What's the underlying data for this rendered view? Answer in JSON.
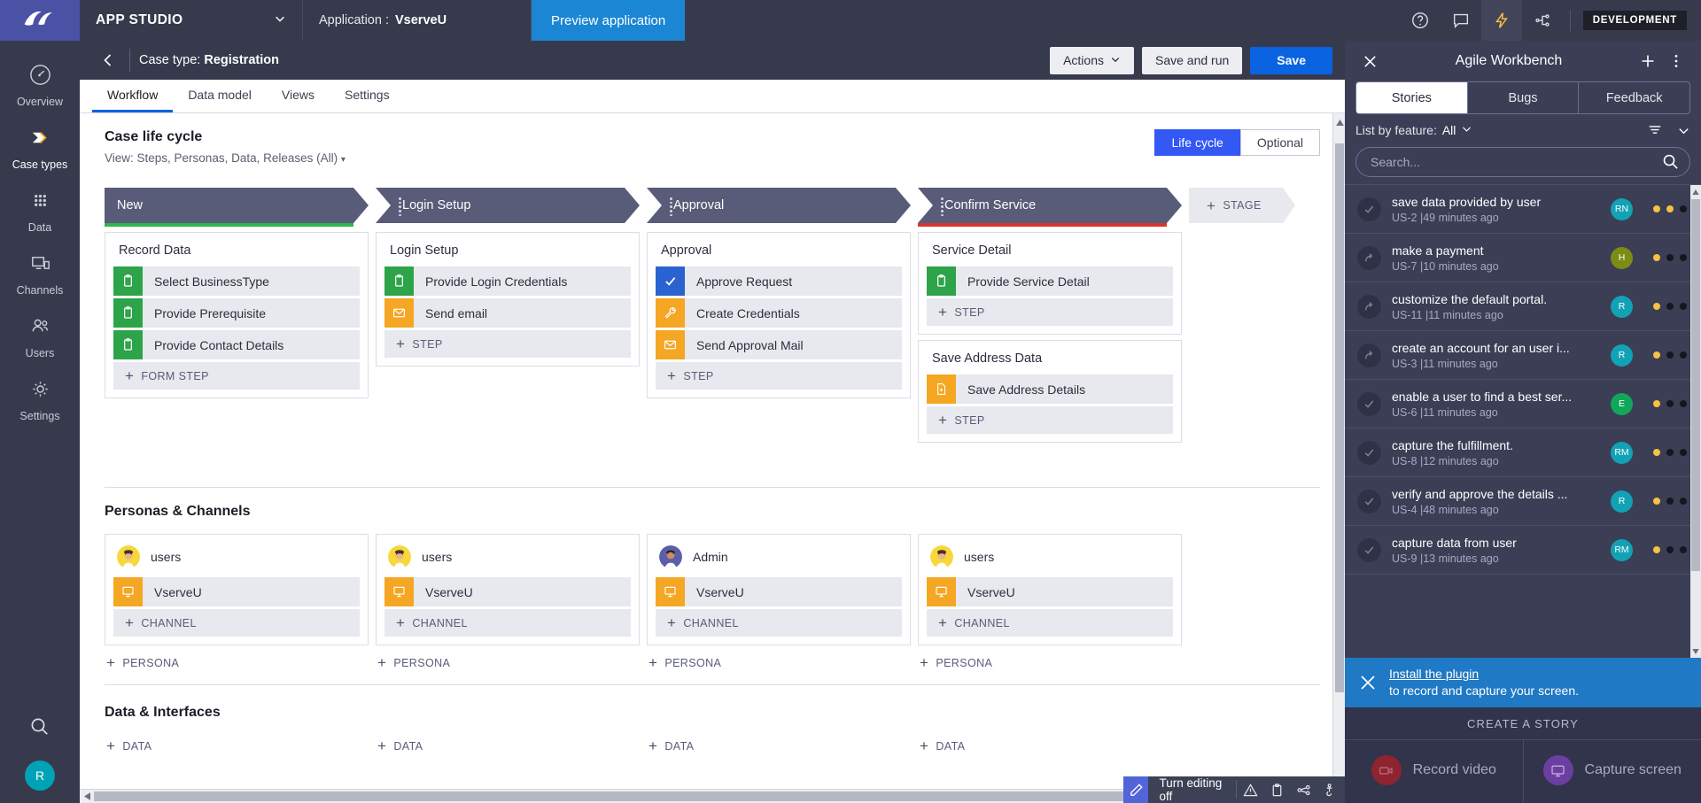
{
  "topbar": {
    "logo_icon": "pega-logo-icon",
    "studio_label": "APP STUDIO",
    "studio_caret_icon": "chevron-down-icon",
    "application_label": "Application :",
    "application_value": "VserveU",
    "preview_label": "Preview application",
    "icons": [
      "help-icon",
      "chat-icon",
      "lightning-icon",
      "share-tree-icon"
    ],
    "env_badge": "DEVELOPMENT"
  },
  "sidebar": {
    "items": [
      {
        "label": "Overview",
        "icon": "gauge-icon",
        "active": false
      },
      {
        "label": "Case types",
        "icon": "case-chevron-icon",
        "active": true
      },
      {
        "label": "Data",
        "icon": "dots-grid-icon",
        "active": false
      },
      {
        "label": "Channels",
        "icon": "devices-icon",
        "active": false
      },
      {
        "label": "Users",
        "icon": "users-icon",
        "active": false
      },
      {
        "label": "Settings",
        "icon": "gear-icon",
        "active": false
      }
    ],
    "search_icon": "search-icon",
    "avatar_initial": "R",
    "avatar_color": "#00a3b5"
  },
  "casebar": {
    "back_icon": "arrow-left-icon",
    "prefix": "Case type:",
    "name": "Registration",
    "actions_label": "Actions",
    "actions_caret_icon": "chevron-down-icon",
    "save_and_run_label": "Save and run",
    "save_label": "Save"
  },
  "tabs": [
    {
      "label": "Workflow",
      "active": true
    },
    {
      "label": "Data model",
      "active": false
    },
    {
      "label": "Views",
      "active": false
    },
    {
      "label": "Settings",
      "active": false
    }
  ],
  "lifecycle": {
    "heading": "Case life cycle",
    "view_line": "View: Steps, Personas, Data, Releases (All)",
    "view_caret": "▾",
    "toggle": [
      {
        "label": "Life cycle",
        "on": true
      },
      {
        "label": "Optional",
        "on": false
      }
    ],
    "add_stage_label": "STAGE",
    "stages": [
      {
        "name": "New",
        "underline_color": "#2db84a",
        "has_grip": false,
        "cards": [
          {
            "title": "Record Data",
            "steps": [
              {
                "label": "Select BusinessType",
                "icon": "clipboard-icon",
                "color": "green"
              },
              {
                "label": "Provide Prerequisite",
                "icon": "clipboard-icon",
                "color": "green"
              },
              {
                "label": "Provide Contact Details",
                "icon": "clipboard-icon",
                "color": "green"
              }
            ],
            "add_label": "FORM STEP"
          }
        ]
      },
      {
        "name": "Login Setup",
        "underline_color": "transparent",
        "has_grip": true,
        "cards": [
          {
            "title": "Login Setup",
            "steps": [
              {
                "label": "Provide Login Credentials",
                "icon": "clipboard-icon",
                "color": "green"
              },
              {
                "label": "Send email",
                "icon": "envelope-icon",
                "color": "orange"
              }
            ],
            "add_label": "STEP"
          }
        ]
      },
      {
        "name": "Approval",
        "underline_color": "transparent",
        "has_grip": true,
        "cards": [
          {
            "title": "Approval",
            "steps": [
              {
                "label": "Approve Request",
                "icon": "check-icon",
                "color": "blue"
              },
              {
                "label": "Create Credentials",
                "icon": "wrench-icon",
                "color": "orange"
              },
              {
                "label": "Send Approval Mail",
                "icon": "envelope-icon",
                "color": "orange"
              }
            ],
            "add_label": "STEP"
          }
        ]
      },
      {
        "name": "Confirm Service",
        "underline_color": "#d9352c",
        "has_grip": true,
        "cards": [
          {
            "title": "Service Detail",
            "steps": [
              {
                "label": "Provide Service Detail",
                "icon": "clipboard-icon",
                "color": "green"
              }
            ],
            "add_label": "STEP"
          },
          {
            "title": "Save Address Data",
            "steps": [
              {
                "label": "Save Address Details",
                "icon": "save-doc-icon",
                "color": "orange"
              }
            ],
            "add_label": "STEP"
          }
        ]
      }
    ]
  },
  "personas": {
    "heading": "Personas & Channels",
    "add_persona_label": "PERSONA",
    "add_channel_label": "CHANNEL",
    "channel_icon": "monitor-icon",
    "columns": [
      {
        "persona": "users",
        "avatar": "female-avatar",
        "channels": [
          {
            "label": "VserveU"
          }
        ]
      },
      {
        "persona": "users",
        "avatar": "female-avatar",
        "channels": [
          {
            "label": "VserveU"
          }
        ]
      },
      {
        "persona": "Admin",
        "avatar": "male-avatar",
        "channels": [
          {
            "label": "VserveU"
          }
        ]
      },
      {
        "persona": "users",
        "avatar": "female-avatar",
        "channels": [
          {
            "label": "VserveU"
          }
        ]
      }
    ]
  },
  "data_interfaces": {
    "heading": "Data & Interfaces",
    "add_label": "DATA",
    "columns": 4
  },
  "edit_toolbar": {
    "pencil_icon": "pencil-icon",
    "label": "Turn editing off",
    "icons": [
      "warning-icon",
      "clipboard-icon",
      "share-nodes-icon",
      "accessibility-icon",
      "close-icon"
    ]
  },
  "workbench": {
    "close_icon": "close-icon",
    "title": "Agile Workbench",
    "add_icon": "plus-icon",
    "more_icon": "kebab-menu-icon",
    "tabs": [
      {
        "label": "Stories",
        "active": true
      },
      {
        "label": "Bugs",
        "active": false
      },
      {
        "label": "Feedback",
        "active": false
      }
    ],
    "filter_label": "List by feature:",
    "filter_value": "All",
    "filter_caret_icon": "chevron-down-icon",
    "sort_icon": "filter-lines-icon",
    "collapse_icon": "chevron-down-icon",
    "search_placeholder": "Search...",
    "search_value": "",
    "search_icon": "search-icon",
    "stories": [
      {
        "title": "save data provided by user",
        "meta": "US-2 |49 minutes ago",
        "status": "check-icon",
        "initials": "RN",
        "avatar_color": "#12a2b5",
        "dots": [
          "#f5c242",
          "#f5c242",
          "#15171f"
        ]
      },
      {
        "title": "make a payment",
        "meta": "US-7 |10 minutes ago",
        "status": "arrow-return-icon",
        "initials": "H",
        "avatar_color": "#7d8c15",
        "dots": [
          "#f5c242",
          "#15171f",
          "#15171f"
        ]
      },
      {
        "title": "customize the default portal.",
        "meta": "US-11 |11 minutes ago",
        "status": "arrow-return-icon",
        "initials": "R",
        "avatar_color": "#12a2b5",
        "dots": [
          "#f5c242",
          "#15171f",
          "#15171f"
        ]
      },
      {
        "title": "create an account for an user i...",
        "meta": "US-3 |11 minutes ago",
        "status": "arrow-return-icon",
        "initials": "R",
        "avatar_color": "#12a2b5",
        "dots": [
          "#f5c242",
          "#15171f",
          "#15171f"
        ]
      },
      {
        "title": "enable a user to find a best ser...",
        "meta": "US-6 |11 minutes ago",
        "status": "check-icon",
        "initials": "E",
        "avatar_color": "#11a75b",
        "dots": [
          "#f5c242",
          "#15171f",
          "#15171f"
        ]
      },
      {
        "title": "capture the fulfillment.",
        "meta": "US-8 |12 minutes ago",
        "status": "check-icon",
        "initials": "RM",
        "avatar_color": "#12a2b5",
        "dots": [
          "#f5c242",
          "#15171f",
          "#15171f"
        ]
      },
      {
        "title": "verify and approve the details ...",
        "meta": "US-4 |48 minutes ago",
        "status": "check-icon",
        "initials": "R",
        "avatar_color": "#12a2b5",
        "dots": [
          "#f5c242",
          "#15171f",
          "#15171f"
        ]
      },
      {
        "title": "capture data from user",
        "meta": "US-9 |13 minutes ago",
        "status": "check-icon",
        "initials": "RM",
        "avatar_color": "#12a2b5",
        "dots": [
          "#f5c242",
          "#15171f",
          "#15171f"
        ]
      }
    ],
    "banner": {
      "close_icon": "close-icon",
      "link_text": "Install the plugin",
      "text": "to record and capture your screen."
    },
    "create_story_label": "CREATE A STORY",
    "actions": [
      {
        "label": "Record video",
        "icon": "video-camera-icon",
        "color": "#8e2430"
      },
      {
        "label": "Capture screen",
        "icon": "monitor-icon",
        "color": "#6b3fa0"
      }
    ]
  }
}
